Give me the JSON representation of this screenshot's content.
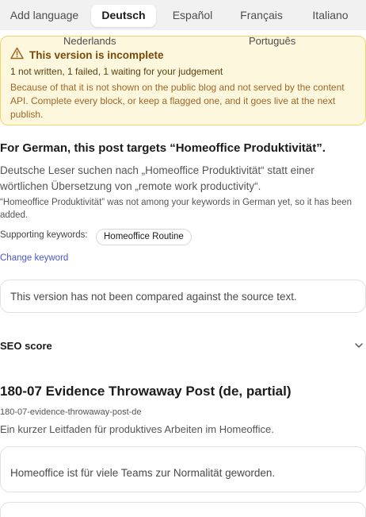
{
  "lang_tabs": {
    "add_language": "Add language",
    "deutsch": "Deutsch",
    "espanol": "Español",
    "francais": "Français",
    "italiano": "Italiano",
    "nederlands": "Nederlands",
    "portugues": "Português"
  },
  "warning": {
    "icon": "warning-triangle-icon",
    "title": "This version is incomplete",
    "summary": "1 not written, 1 failed, 1 waiting for your judgement",
    "detail": "Because of that it is not shown on the public blog and not served by the content API. Complete every block, or keep a flagged one, and it goes live at the next publish."
  },
  "target": {
    "heading": "For German, this post targets “Homeoffice Produktivität”.",
    "description": "Deutsche Leser suchen nach „Homeoffice Produktivität“ statt einer wörtlichen Übersetzung von „remote work productivity“.",
    "note": "“Homeoffice Produktivität” was not among your keywords in German yet, so it has been added.",
    "supporting_label": "Supporting keywords:",
    "supporting_keywords": [
      "Homeoffice Routine"
    ],
    "change_keyword": "Change keyword"
  },
  "comparison_notice": "This version has not been compared against the source text.",
  "seo": {
    "label": "SEO score",
    "expand_icon": "chevron-down-icon"
  },
  "post": {
    "title": "180-07 Evidence Throwaway Post (de, partial)",
    "slug": "180-07-evidence-throwaway-post-de",
    "excerpt": "Ein kurzer Leitfaden für produktives Arbeiten im Homeoffice.",
    "first_block": "Homeoffice ist für viele Teams zur Normalität geworden."
  },
  "colors": {
    "warning_bg": "#fdf7dd",
    "warning_border": "#f2d46d",
    "warning_title": "#7a4a0a",
    "link": "#4a56c9"
  }
}
